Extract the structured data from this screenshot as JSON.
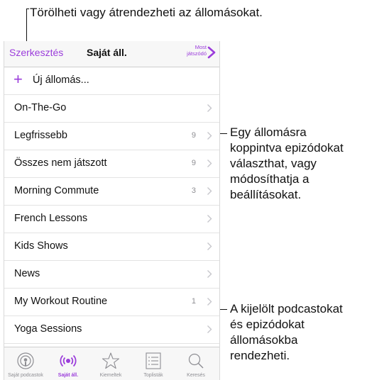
{
  "callouts": {
    "top": "Törölheti vagy átrendezheti az állomásokat.",
    "middle": [
      "Egy állomásra",
      "koppintva epizódokat",
      "választhat, vagy",
      "módosíthatja a",
      "beállításokat."
    ],
    "bottom": [
      "A kijelölt podcastokat",
      "és epizódokat",
      "állomásokba",
      "rendezheti."
    ]
  },
  "navbar": {
    "edit_label": "Szerkesztés",
    "title": "Saját áll.",
    "now_playing_line1": "Most",
    "now_playing_line2": "játszódó"
  },
  "new_station": {
    "label": "Új állomás..."
  },
  "stations": [
    {
      "label": "On-The-Go",
      "count": ""
    },
    {
      "label": "Legfrissebb",
      "count": "9"
    },
    {
      "label": "Összes nem játszott",
      "count": "9"
    },
    {
      "label": "Morning Commute",
      "count": "3"
    },
    {
      "label": "French Lessons",
      "count": ""
    },
    {
      "label": "Kids Shows",
      "count": ""
    },
    {
      "label": "News",
      "count": ""
    },
    {
      "label": "My Workout Routine",
      "count": "1"
    },
    {
      "label": "Yoga Sessions",
      "count": ""
    }
  ],
  "tabs": [
    {
      "label": "Saját podcastok",
      "icon": "podcast-icon"
    },
    {
      "label": "Saját áll.",
      "icon": "station-icon"
    },
    {
      "label": "Kiemeltek",
      "icon": "star-icon"
    },
    {
      "label": "Toplisták",
      "icon": "list-icon"
    },
    {
      "label": "Keresés",
      "icon": "search-icon"
    }
  ],
  "colors": {
    "accent": "#9b3ddb",
    "secondary": "#8e8e93"
  }
}
